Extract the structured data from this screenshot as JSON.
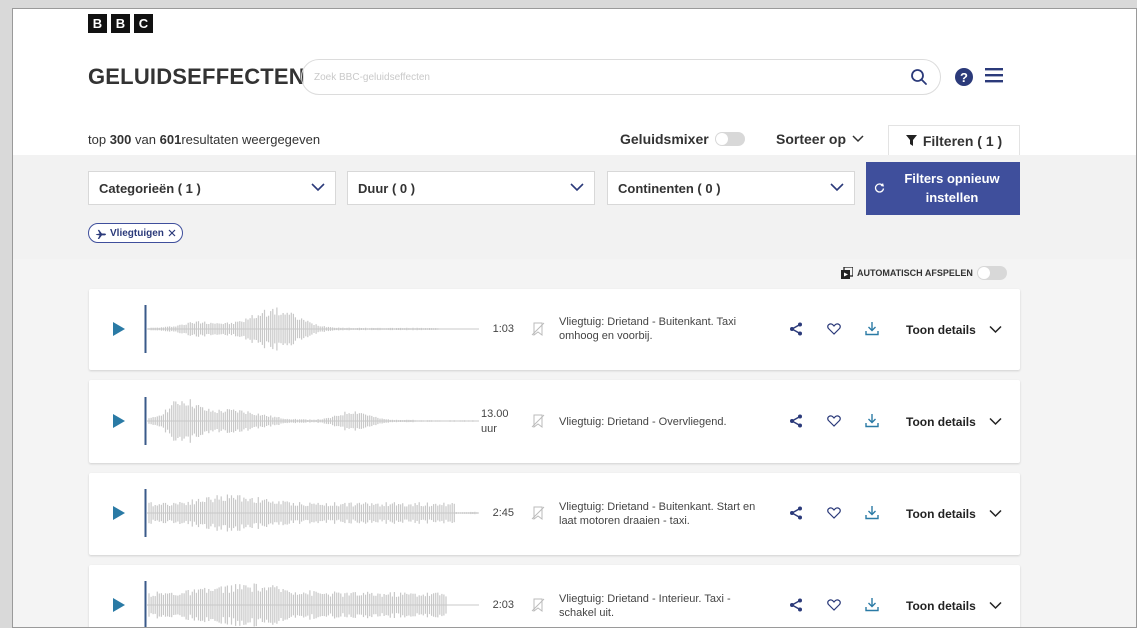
{
  "brand": {
    "logo_letters": [
      "B",
      "B",
      "C"
    ]
  },
  "header": {
    "title": "GELUIDSEFFECTEN",
    "search_placeholder": "Zoek BBC-geluidseffecten",
    "help_label": "?"
  },
  "results": {
    "prefix": "top",
    "shown": "300",
    "middle": "van",
    "total": "601",
    "suffix": "resultaten weergegeven"
  },
  "toolbar": {
    "mixer_label": "Geluidsmixer",
    "sort_label": "Sorteer op",
    "filter_label": "Filteren ( 1 )"
  },
  "filters": {
    "categories": "Categorieën ( 1 )",
    "duration": "Duur ( 0 )",
    "continents": "Continenten ( 0 )",
    "reset_line1": "Filters opnieuw",
    "reset_line2": "instellen",
    "chip_label": "Vliegtuigen"
  },
  "autoplay_label": "AUTOMATISCH AFSPELEN",
  "sounds": [
    {
      "duration": "1:03",
      "description": "Vliegtuig: Drietand - Buitenkant. Taxi omhoog en voorbij.",
      "details_label": "Toon details"
    },
    {
      "duration": "13.00 uur",
      "duration_line1": "13.00",
      "duration_line2": "uur",
      "description": "Vliegtuig: Drietand - Overvliegend.",
      "details_label": "Toon details"
    },
    {
      "duration": "2:45",
      "description": "Vliegtuig: Drietand - Buitenkant. Start en laat motoren draaien - taxi.",
      "details_label": "Toon details"
    },
    {
      "duration": "2:03",
      "description": "Vliegtuig: Drietand - Interieur. Taxi - schakel uit.",
      "details_label": "Toon details"
    }
  ],
  "colors": {
    "accent": "#3f4f9c",
    "play": "#2a7aa5",
    "waveform": "#c8c8c8"
  }
}
